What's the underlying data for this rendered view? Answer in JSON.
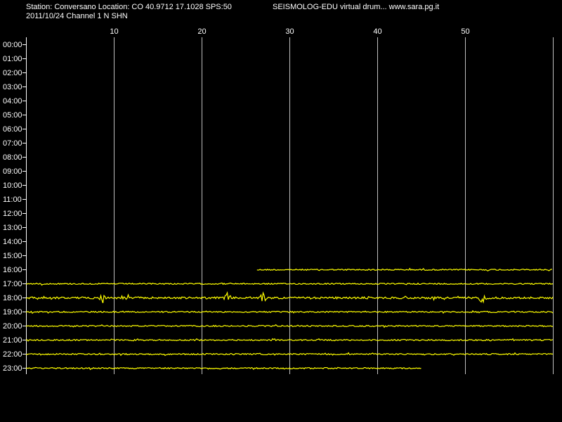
{
  "header": {
    "station_info": "Station: Conversano Location: CO 40.9712 17.1028 SPS:50",
    "app_info": "SEISMOLOG-EDU virtual drum... www.sara.pg.it",
    "date_channel": "2011/10/24  Channel 1 N SHN"
  },
  "colors": {
    "background": "#000000",
    "trace": "#ffff00",
    "grid": "#c0c0c0",
    "axis": "#ffffff",
    "text": "#ffffff"
  },
  "chart_data": {
    "type": "line",
    "x_ticks": [
      10,
      20,
      30,
      40,
      50
    ],
    "xlim": [
      0,
      60
    ],
    "y_labels": [
      "00:00",
      "01:00",
      "02:00",
      "03:00",
      "04:00",
      "05:00",
      "06:00",
      "07:00",
      "08:00",
      "09:00",
      "10:00",
      "11:00",
      "12:00",
      "13:00",
      "14:00",
      "15:00",
      "16:00",
      "17:00",
      "18:00",
      "19:00",
      "20:00",
      "21:00",
      "22:00",
      "23:00"
    ],
    "grid": true,
    "series": [
      {
        "hour": "16:00",
        "start_min": 26.3,
        "end_min": 60,
        "noise": "low"
      },
      {
        "hour": "17:00",
        "start_min": 0,
        "end_min": 60,
        "noise": "low"
      },
      {
        "hour": "18:00",
        "start_min": 0,
        "end_min": 60,
        "noise": "medium",
        "events_min": [
          8.8,
          11.4,
          23.0,
          27.0,
          52.0
        ]
      },
      {
        "hour": "19:00",
        "start_min": 0,
        "end_min": 60,
        "noise": "low"
      },
      {
        "hour": "20:00",
        "start_min": 0,
        "end_min": 60,
        "noise": "low"
      },
      {
        "hour": "21:00",
        "start_min": 0,
        "end_min": 60,
        "noise": "low"
      },
      {
        "hour": "22:00",
        "start_min": 0,
        "end_min": 60,
        "noise": "low"
      },
      {
        "hour": "23:00",
        "start_min": 0,
        "end_min": 45,
        "noise": "low"
      }
    ]
  }
}
